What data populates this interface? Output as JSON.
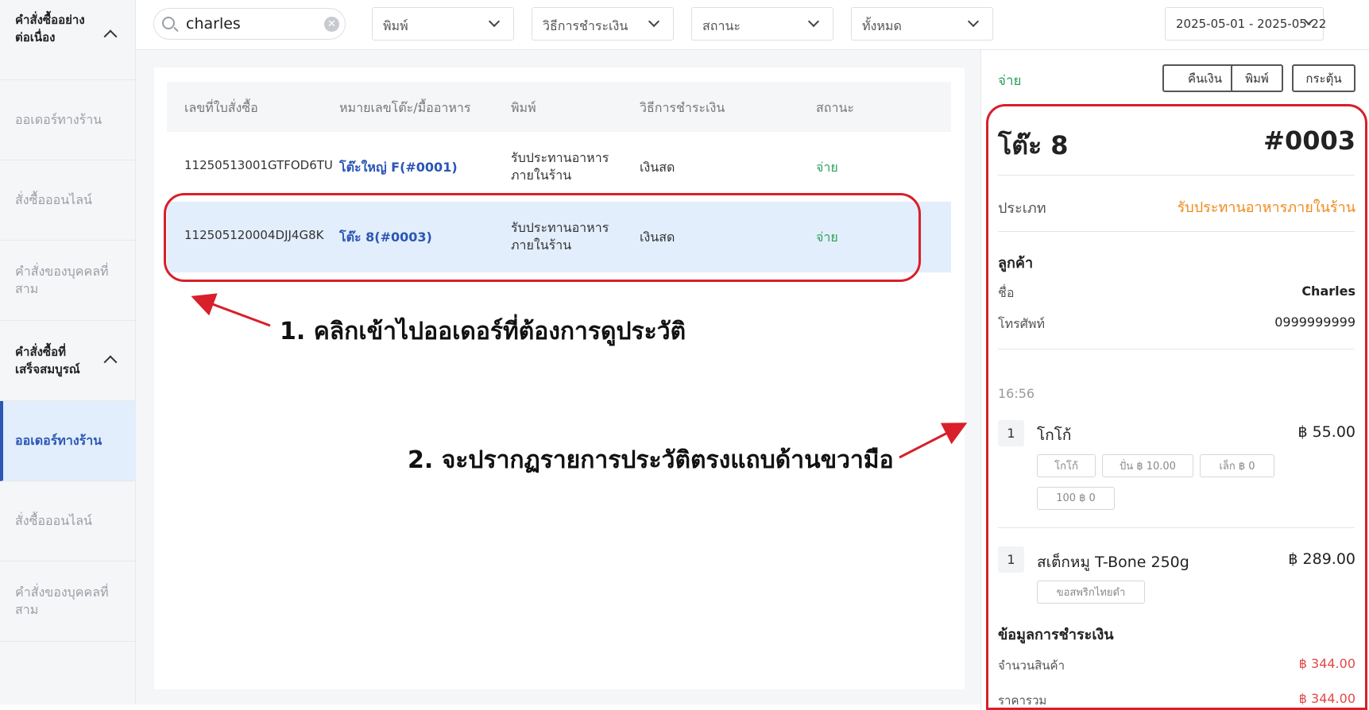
{
  "sidebar": {
    "group1": "คำสั่งซื้ออย่างต่อเนื่อง",
    "group1_items": [
      "ออเดอร์ทางร้าน",
      "สั่งซื้อออนไลน์",
      "คำสั่งของบุคคลที่สาม"
    ],
    "group2": "คำสั่งซื้อที่เสร็จสมบูรณ์",
    "group2_items": [
      "ออเดอร์ทางร้าน",
      "สั่งซื้อออนไลน์",
      "คำสั่งของบุคคลที่สาม"
    ]
  },
  "filters": {
    "search_value": "charles",
    "type": "พิมพ์",
    "payment": "วิธีการชำระเงิน",
    "status": "สถานะ",
    "all": "ทั้งหมด",
    "date_range": "2025-05-01 - 2025-05-22"
  },
  "table": {
    "headers": [
      "เลขที่ใบสั่งซื้อ",
      "หมายเลขโต๊ะ/มื้ออาหาร",
      "พิมพ์",
      "วิธีการชำระเงิน",
      "สถานะ"
    ],
    "rows": [
      {
        "order_no": "11250513001GTFOD6TU",
        "table": "โต๊ะใหญ่ F(#0001)",
        "type": "รับประทานอาหารภายในร้าน",
        "payment": "เงินสด",
        "status": "จ่าย"
      },
      {
        "order_no": "112505120004DJJ4G8K",
        "table": "โต๊ะ 8(#0003)",
        "type": "รับประทานอาหารภายในร้าน",
        "payment": "เงินสด",
        "status": "จ่าย"
      }
    ]
  },
  "detail": {
    "status": "จ่าย",
    "buttons": [
      "คืนเงิน",
      "พิมพ์",
      "กระตุ้น"
    ],
    "table_name": "โต๊ะ 8",
    "order_id": "#0003",
    "type_label": "ประเภท",
    "type_value": "รับประทานอาหารภายในร้าน",
    "customer_title": "ลูกค้า",
    "name_label": "ชื่อ",
    "name_value": "Charles",
    "phone_label": "โทรศัพท์",
    "phone_value": "0999999999",
    "time": "16:56",
    "items": [
      {
        "qty": "1",
        "name": "โกโก้",
        "price": "฿ 55.00",
        "options": [
          "โกโก้",
          "ปั่น ฿ 10.00",
          "เล็ก ฿ 0",
          "100 ฿ 0"
        ]
      },
      {
        "qty": "1",
        "name": "สเต็กหมู T-Bone 250g",
        "price": "฿ 289.00",
        "options": [
          "ขอสพริกไทยดำ"
        ]
      }
    ],
    "payment_title": "ข้อมูลการชำระเงิน",
    "qty_label": "จำนวนสินค้า",
    "qty_value": "฿ 344.00",
    "total_label": "ราคารวม",
    "total_value": "฿ 344.00"
  },
  "annotations": {
    "step1": "1. คลิกเข้าไปออเดอร์ที่ต้องการดูประวัติ",
    "step2": "2. จะปรากฏรายการประวัติตรงแถบด้านขวามือ"
  },
  "colors": {
    "accent": "#2a56b5",
    "paid": "#2aa05a",
    "type_orange": "#f08a1c",
    "highlight_red": "#d81f2a",
    "amount_red": "#e24848"
  }
}
